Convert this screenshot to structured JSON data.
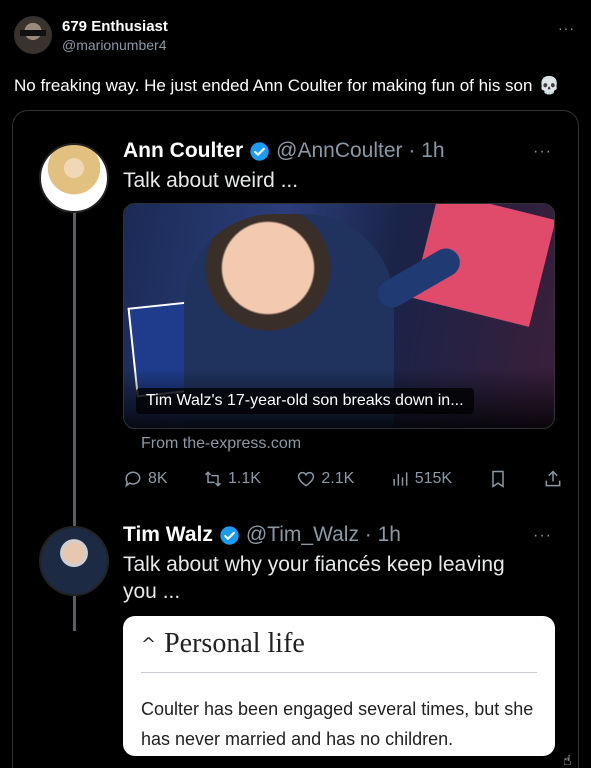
{
  "author": {
    "name": "679 Enthusiast",
    "handle": "@marionumber4",
    "more": "···"
  },
  "tweet": {
    "text": "No freaking way. He just ended Ann Coulter for making fun of his son",
    "emoji": "💀"
  },
  "quoted_post": {
    "name": "Ann Coulter",
    "meta": "@AnnCoulter · 1h",
    "text": "Talk about weird ...",
    "more": "···",
    "media_caption": "Tim Walz's 17-year-old son breaks down in...",
    "link_source": "From the-express.com",
    "actions": {
      "replies": "8K",
      "reposts": "1.1K",
      "likes": "2.1K",
      "views": "515K"
    }
  },
  "reply_post": {
    "name": "Tim Walz",
    "meta": "@Tim_Walz · 1h",
    "text": "Talk about why your fiancés keep leaving you ...",
    "more": "···",
    "card": {
      "heading": "Personal life",
      "chevron": "^",
      "text": "Coulter has been engaged several times, but she has never married and has no children."
    }
  },
  "colors": {
    "background": "#000000",
    "muted": "#8b98a5",
    "verified": "#1d9bf0"
  }
}
